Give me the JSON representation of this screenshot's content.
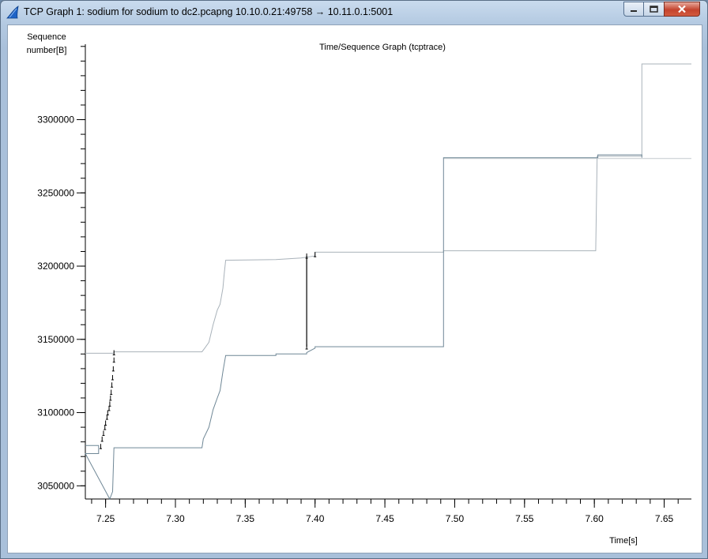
{
  "window": {
    "title": "TCP Graph 1: sodium for sodium to dc2.pcapng 10.10.0.21:49758 → 10.11.0.1:5001",
    "icon": "wireshark-fin-icon",
    "buttons": [
      "minimize",
      "maximize",
      "close"
    ]
  },
  "chart_data": {
    "type": "line",
    "title": "Time/Sequence Graph (tcptrace)",
    "ylabel_line1": "Sequence",
    "ylabel_line2": "number[B]",
    "xlabel": "Time[s]",
    "xlim": [
      7.2355,
      7.6695
    ],
    "ylim": [
      3041000,
      3351500
    ],
    "xticks": [
      7.25,
      7.3,
      7.35,
      7.4,
      7.45,
      7.5,
      7.55,
      7.6,
      7.65
    ],
    "xtick_labels": [
      "7.25",
      "7.30",
      "7.35",
      "7.40",
      "7.45",
      "7.50",
      "7.55",
      "7.60",
      "7.65"
    ],
    "yticks": [
      3050000,
      3100000,
      3150000,
      3200000,
      3250000,
      3300000
    ],
    "ytick_labels": [
      "3050000",
      "3100000",
      "3150000",
      "3200000",
      "3250000",
      "3300000"
    ],
    "grid": false,
    "series": [
      {
        "role": "receive-window",
        "color": "#a9b2ba",
        "points": [
          [
            7.2355,
            3140500
          ],
          [
            7.256,
            3140500
          ],
          [
            7.256,
            3141500
          ],
          [
            7.319,
            3141500
          ],
          [
            7.321,
            3144000
          ],
          [
            7.324,
            3148000
          ],
          [
            7.327,
            3160000
          ],
          [
            7.33,
            3170000
          ],
          [
            7.332,
            3174000
          ],
          [
            7.334,
            3185000
          ],
          [
            7.335,
            3195000
          ],
          [
            7.336,
            3204000
          ],
          [
            7.372,
            3204500
          ],
          [
            7.39,
            3205500
          ],
          [
            7.4,
            3207000
          ],
          [
            7.4,
            3209500
          ],
          [
            7.492,
            3209500
          ],
          [
            7.492,
            3210500
          ],
          [
            7.601,
            3210500
          ],
          [
            7.602,
            3275000
          ],
          [
            7.634,
            3275000
          ],
          [
            7.634,
            3338000
          ],
          [
            7.6695,
            3338000
          ]
        ]
      },
      {
        "role": "receive-window-upper",
        "color": "#c3c9ce",
        "points": [
          [
            7.492,
            3273500
          ],
          [
            7.6695,
            3273500
          ]
        ]
      },
      {
        "role": "ack-line",
        "color": "#6f8796",
        "points": [
          [
            7.2355,
            3077500
          ],
          [
            7.245,
            3077500
          ],
          [
            7.245,
            3072000
          ],
          [
            7.2355,
            3072000
          ],
          [
            7.253,
            3041000
          ],
          [
            7.255,
            3046000
          ],
          [
            7.256,
            3076000
          ],
          [
            7.319,
            3076000
          ],
          [
            7.32,
            3082000
          ],
          [
            7.324,
            3090000
          ],
          [
            7.327,
            3102000
          ],
          [
            7.33,
            3110000
          ],
          [
            7.332,
            3115000
          ],
          [
            7.334,
            3128000
          ],
          [
            7.336,
            3139000
          ],
          [
            7.372,
            3139000
          ],
          [
            7.372,
            3140000
          ],
          [
            7.394,
            3140000
          ],
          [
            7.394,
            3141000
          ],
          [
            7.4,
            3144000
          ],
          [
            7.4,
            3145000
          ],
          [
            7.492,
            3145000
          ],
          [
            7.492,
            3274000
          ],
          [
            7.6025,
            3274000
          ],
          [
            7.6025,
            3276000
          ],
          [
            7.634,
            3276000
          ],
          [
            7.634,
            3274000
          ]
        ]
      },
      {
        "role": "segments",
        "color": "#000000",
        "points": [
          [
            7.2465,
            3077000
          ],
          [
            7.2475,
            3082000
          ],
          [
            7.2485,
            3086000
          ],
          [
            7.2495,
            3090000
          ],
          [
            7.25,
            3093000
          ],
          [
            7.251,
            3097000
          ],
          [
            7.2515,
            3100000
          ],
          [
            7.2525,
            3103000
          ],
          [
            7.253,
            3106000
          ],
          [
            7.2535,
            3110000
          ],
          [
            7.254,
            3114000
          ],
          [
            7.2545,
            3119000
          ],
          [
            7.255,
            3124000
          ],
          [
            7.2555,
            3130000
          ],
          [
            7.256,
            3136000
          ],
          [
            7.256,
            3141000
          ],
          [
            7.394,
            3145000
          ],
          [
            7.394,
            3207000
          ],
          [
            7.4,
            3208000
          ]
        ]
      }
    ]
  }
}
